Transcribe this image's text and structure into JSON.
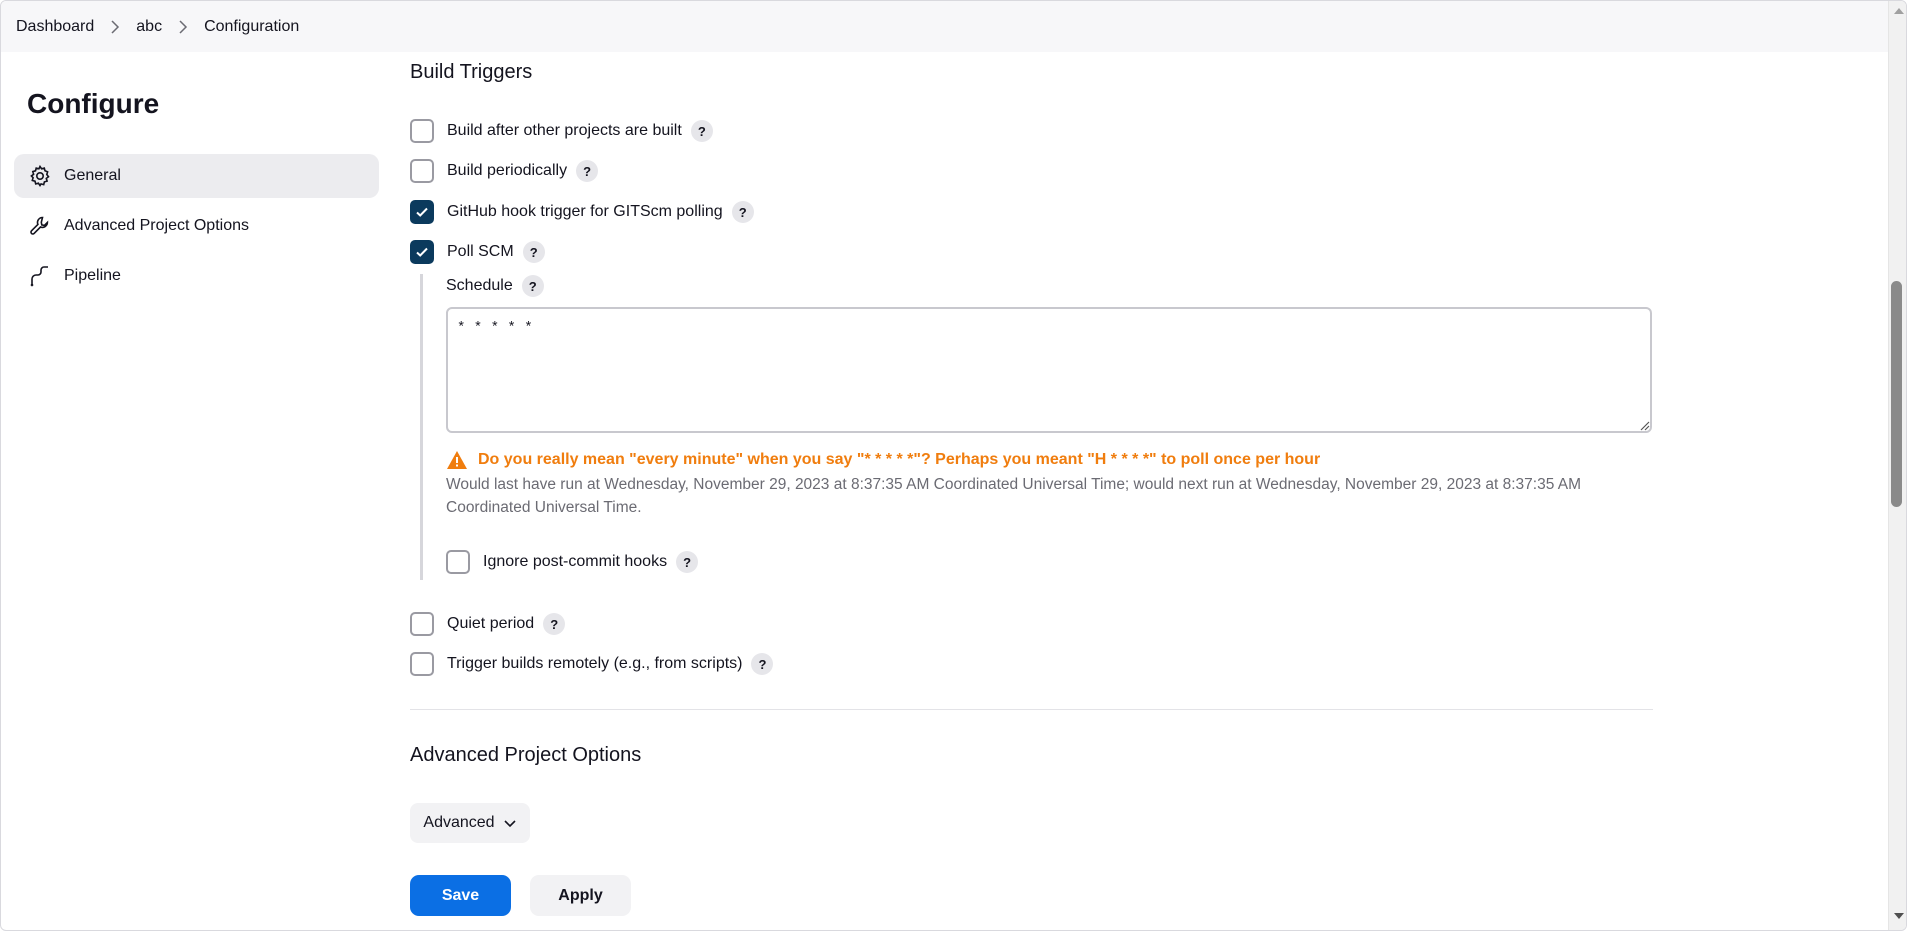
{
  "breadcrumb": {
    "items": [
      "Dashboard",
      "abc",
      "Configuration"
    ]
  },
  "sidebar": {
    "title": "Configure",
    "items": [
      {
        "label": "General",
        "icon": "gear-icon",
        "active": true
      },
      {
        "label": "Advanced Project Options",
        "icon": "wrench-icon",
        "active": false
      },
      {
        "label": "Pipeline",
        "icon": "pipeline-icon",
        "active": false
      }
    ]
  },
  "build_triggers": {
    "title": "Build Triggers",
    "options": [
      {
        "label": "Build after other projects are built",
        "checked": false
      },
      {
        "label": "Build periodically",
        "checked": false
      },
      {
        "label": "GitHub hook trigger for GITScm polling",
        "checked": true
      },
      {
        "label": "Poll SCM",
        "checked": true
      }
    ],
    "schedule": {
      "label": "Schedule",
      "value": "* * * * *",
      "warning": "Do you really mean \"every minute\" when you say \"* * * * *\"? Perhaps you meant \"H * * * *\" to poll once per hour",
      "note": "Would last have run at Wednesday, November 29, 2023 at 8:37:35 AM Coordinated Universal Time; would next run at Wednesday, November 29, 2023 at 8:37:35 AM Coordinated Universal Time."
    },
    "ignore_hooks": {
      "label": "Ignore post-commit hooks",
      "checked": false
    },
    "more_options": [
      {
        "label": "Quiet period",
        "checked": false
      },
      {
        "label": "Trigger builds remotely (e.g., from scripts)",
        "checked": false
      }
    ]
  },
  "advanced_options": {
    "title": "Advanced Project Options",
    "button_label": "Advanced"
  },
  "actions": {
    "save_label": "Save",
    "apply_label": "Apply"
  },
  "help_glyph": "?",
  "colors": {
    "accent": "#0b6fe4",
    "checkbox_checked": "#0b3a5d",
    "warning": "#f07d0e"
  }
}
